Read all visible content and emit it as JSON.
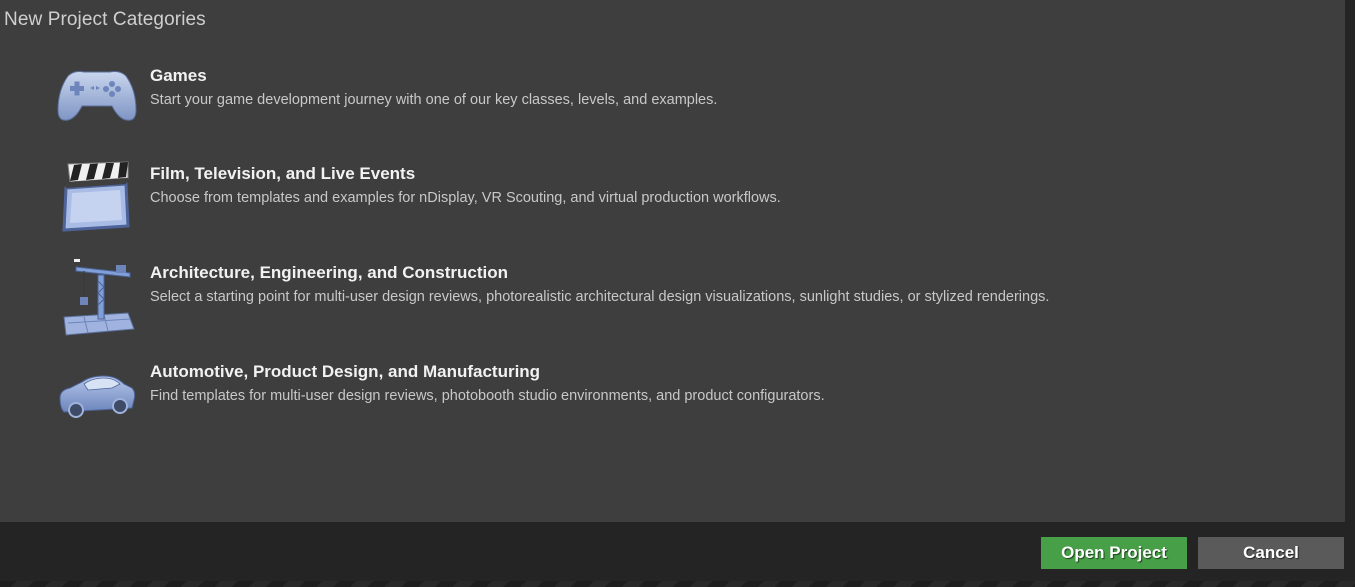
{
  "panel": {
    "title": "New Project Categories"
  },
  "categories": [
    {
      "title": "Games",
      "description": "Start your game development journey with one of our key classes, levels, and examples.",
      "icon": "gamepad-icon"
    },
    {
      "title": "Film, Television, and Live Events",
      "description": "Choose from templates and examples for nDisplay, VR Scouting, and virtual production workflows.",
      "icon": "clapperboard-icon"
    },
    {
      "title": "Architecture, Engineering, and Construction",
      "description": "Select a starting point for multi-user design reviews, photorealistic architectural design visualizations, sunlight studies, or stylized renderings.",
      "icon": "crane-icon"
    },
    {
      "title": "Automotive, Product Design, and Manufacturing",
      "description": "Find templates for multi-user design reviews, photobooth studio environments, and product configurators.",
      "icon": "car-icon"
    }
  ],
  "footer": {
    "open_label": "Open Project",
    "cancel_label": "Cancel"
  },
  "colors": {
    "panel_bg": "#3e3e3e",
    "footer_bg": "#242424",
    "open_button": "#47a047",
    "cancel_button": "#5a5a5a",
    "icon_blue": "#7f9fd6"
  }
}
